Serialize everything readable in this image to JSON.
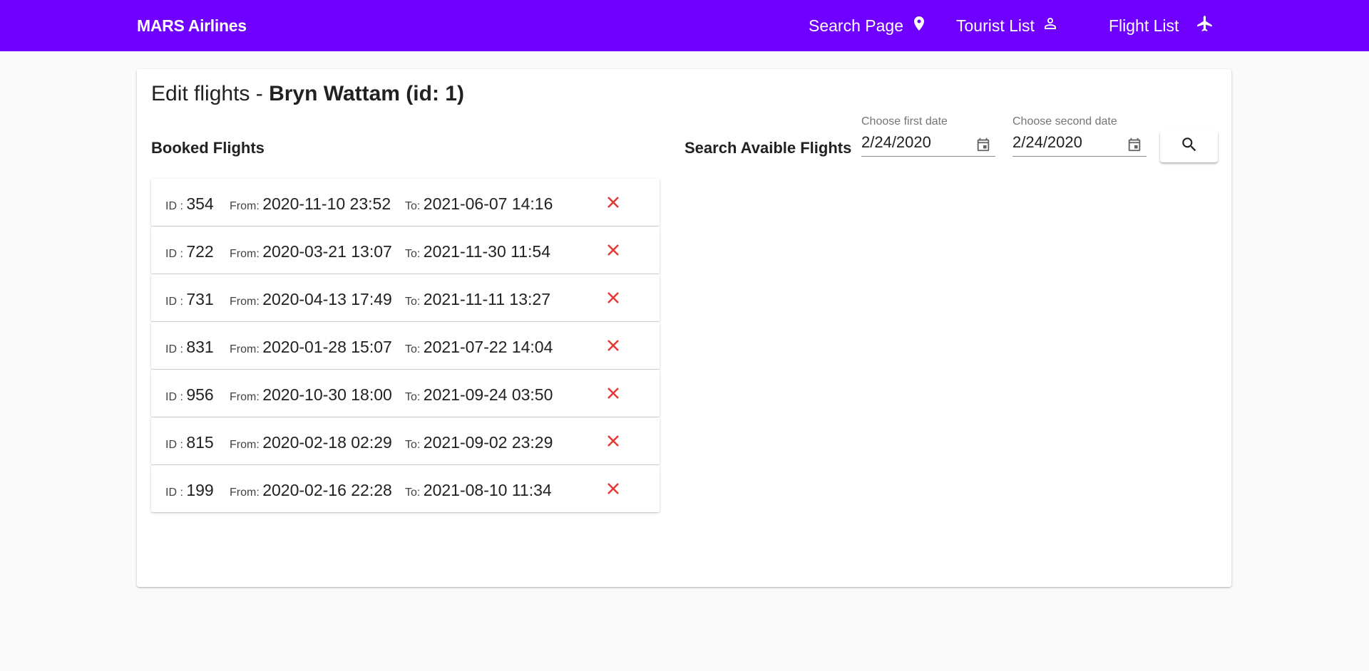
{
  "header": {
    "brand": "MARS Airlines",
    "nav": [
      {
        "label": "Search Page",
        "icon": "location-pin-icon"
      },
      {
        "label": "Tourist List",
        "icon": "person-icon"
      },
      {
        "label": "Flight List",
        "icon": "airplane-icon"
      }
    ]
  },
  "page": {
    "title_prefix": "Edit flights - ",
    "title_name": "Bryn Wattam (id: 1)",
    "booked_label": "Booked Flights",
    "search_label": "Search Avaible Flights"
  },
  "search": {
    "first_date_label": "Choose first date",
    "first_date_value": "2/24/2020",
    "second_date_label": "Choose second date",
    "second_date_value": "2/24/2020",
    "button_icon": "search-icon"
  },
  "flight_labels": {
    "id": "ID : ",
    "from": "From: ",
    "to": "To: "
  },
  "flights": [
    {
      "id": "354",
      "from": "2020-11-10 23:52",
      "to": "2021-06-07 14:16"
    },
    {
      "id": "722",
      "from": "2020-03-21 13:07",
      "to": "2021-11-30 11:54"
    },
    {
      "id": "731",
      "from": "2020-04-13 17:49",
      "to": "2021-11-11 13:27"
    },
    {
      "id": "831",
      "from": "2020-01-28 15:07",
      "to": "2021-07-22 14:04"
    },
    {
      "id": "956",
      "from": "2020-10-30 18:00",
      "to": "2021-09-24 03:50"
    },
    {
      "id": "815",
      "from": "2020-02-18 02:29",
      "to": "2021-09-02 23:29"
    },
    {
      "id": "199",
      "from": "2020-02-16 22:28",
      "to": "2021-08-10 11:34"
    }
  ],
  "colors": {
    "accent": "#6f00ff",
    "delete": "#e53935"
  }
}
